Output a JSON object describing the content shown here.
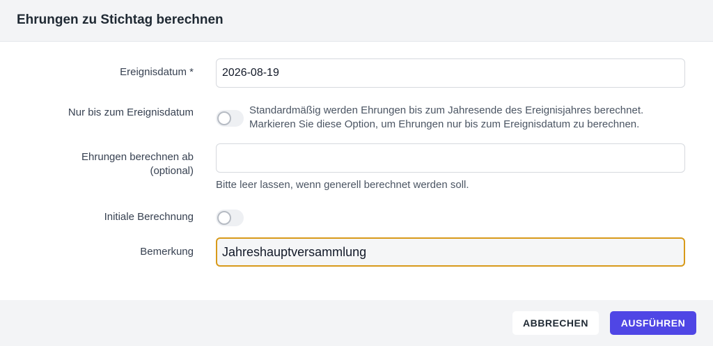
{
  "dialog": {
    "title": "Ehrungen zu Stichtag berechnen"
  },
  "form": {
    "event_date": {
      "label": "Ereignisdatum *",
      "value": "2026-08-19"
    },
    "only_until_event": {
      "label": "Nur bis zum Ereignisdatum",
      "checked": false,
      "help_line1": "Standardmäßig werden Ehrungen bis zum Jahresende des Ereignisjahres berechnet.",
      "help_line2": "Markieren Sie diese Option, um Ehrungen nur bis zum Ereignisdatum zu berechnen."
    },
    "calc_from": {
      "label_line1": "Ehrungen berechnen ab",
      "label_line2": "(optional)",
      "value": "",
      "hint": "Bitte leer lassen, wenn generell berechnet werden soll."
    },
    "initial_calc": {
      "label": "Initiale Berechnung",
      "checked": false
    },
    "remark": {
      "label": "Bemerkung",
      "value": "Jahreshauptversammlung"
    }
  },
  "footer": {
    "cancel_label": "ABBRECHEN",
    "run_label": "AUSFÜHREN"
  },
  "colors": {
    "primary": "#4f46e5",
    "focus_border": "#d89a1a",
    "header_bg": "#f3f4f6"
  }
}
